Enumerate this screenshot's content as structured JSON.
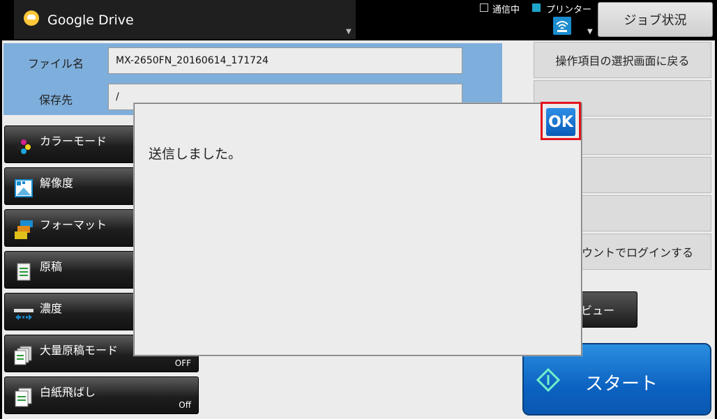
{
  "header": {
    "app_title": "Google Drive",
    "status_comm": "通信中",
    "status_printer": "プリンター",
    "job_status_label": "ジョブ状況"
  },
  "file": {
    "name_label": "ファイル名",
    "name_value": "MX-2650FN_20160614_171724",
    "dest_label": "保存先",
    "dest_value": "/"
  },
  "settings": [
    {
      "label": "カラーモード",
      "value": ""
    },
    {
      "label": "解像度",
      "value": ""
    },
    {
      "label": "フォーマット",
      "value": ""
    },
    {
      "label": "原稿",
      "value": ""
    },
    {
      "label": "濃度",
      "value": ""
    },
    {
      "label": "大量原稿モード",
      "value": "OFF"
    },
    {
      "label": "白紙飛ばし",
      "value": "Off"
    }
  ],
  "right_panel": {
    "back_label": "操作項目の選択画面に戻る",
    "login_label": "ウントでログインする",
    "preview_label": "ビュー",
    "start_label": "スタート"
  },
  "dialog": {
    "message": "送信しました。",
    "ok_label": "OK"
  },
  "colors": {
    "accent_blue": "#1a8ccf",
    "highlight_red": "#e3141b",
    "file_panel_blue": "#7eaedb"
  }
}
